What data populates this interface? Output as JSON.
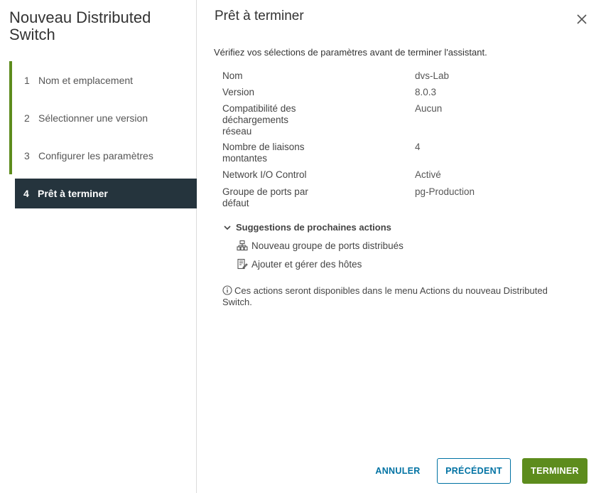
{
  "wizard": {
    "title": "Nouveau Distributed Switch",
    "steps": [
      {
        "num": "1",
        "label": "Nom et emplacement"
      },
      {
        "num": "2",
        "label": "Sélectionner une version"
      },
      {
        "num": "3",
        "label": "Configurer les paramètres"
      },
      {
        "num": "4",
        "label": "Prêt à terminer"
      }
    ],
    "active_step": 4
  },
  "page": {
    "title": "Prêt à terminer",
    "intro": "Vérifiez vos sélections de paramètres avant de terminer l'assistant."
  },
  "params": [
    {
      "key": "Nom",
      "value": "dvs-Lab"
    },
    {
      "key": "Version",
      "value": "8.0.3"
    },
    {
      "key": "Compatibilité des déchargements réseau",
      "value": "Aucun"
    },
    {
      "key": "Nombre de liaisons montantes",
      "value": "4"
    },
    {
      "key": "Network I/O Control",
      "value": "Activé"
    },
    {
      "key": "Groupe de ports par défaut",
      "value": "pg-Production"
    }
  ],
  "next_actions": {
    "header": "Suggestions de prochaines actions",
    "items": [
      {
        "label": "Nouveau groupe de ports distribués",
        "icon": "port-group-icon"
      },
      {
        "label": "Ajouter et gérer des hôtes",
        "icon": "hosts-icon"
      }
    ],
    "info": "Ces actions seront disponibles dans le menu Actions du nouveau Distributed Switch."
  },
  "buttons": {
    "cancel": "ANNULER",
    "previous": "PRÉCÉDENT",
    "finish": "TERMINER"
  },
  "colors": {
    "accent_green": "#5d8c1d",
    "active_step_bg": "#25343d",
    "link_blue": "#0072a3"
  }
}
